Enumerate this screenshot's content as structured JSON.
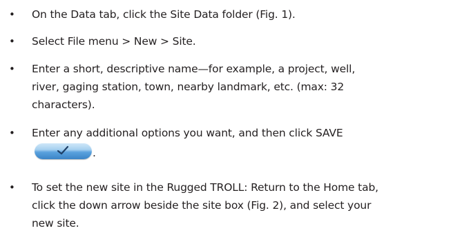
{
  "bullet_glyph": "•",
  "steps": [
    {
      "lines": [
        "On the Data tab, click the Site Data folder (Fig. 1)."
      ]
    },
    {
      "lines": [
        "Select File menu > New > Site."
      ]
    },
    {
      "lines": [
        "Enter a short, descriptive name—for example, a project, well,",
        "river, gaging station, town, nearby landmark, etc. (max: 32",
        "characters)."
      ]
    },
    {
      "lines": [
        "Enter any additional options you want, and then click SAVE"
      ],
      "button_icon": "checkmark-icon",
      "after_button": "."
    },
    {
      "lines": [
        "To set the new site in the Rugged TROLL: Return to the Home tab,",
        "click the down arrow beside the site box (Fig. 2), and select your",
        "new site."
      ]
    }
  ]
}
